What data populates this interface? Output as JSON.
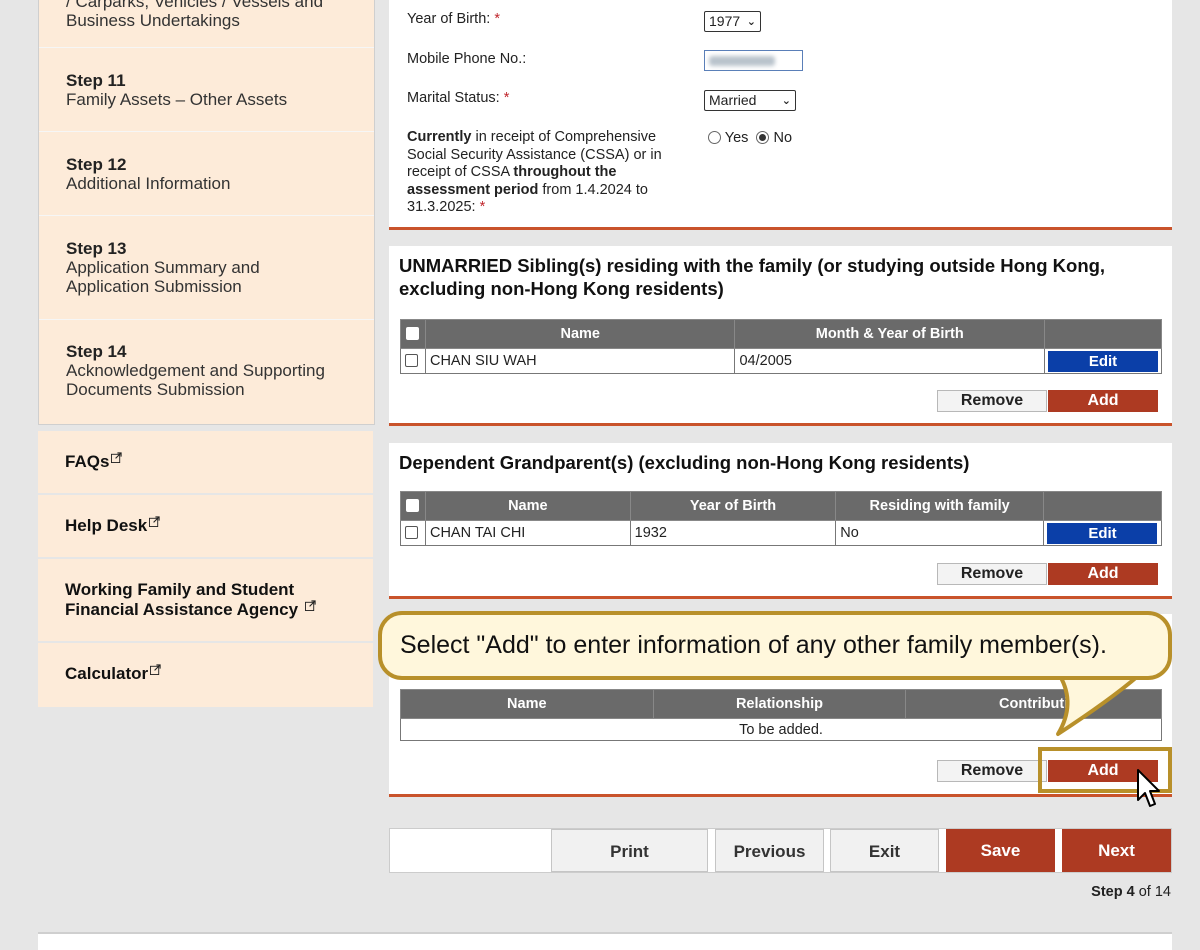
{
  "sidebar": {
    "partial_top": "/ Carparks, Vehicles / Vessels and Business Undertakings",
    "steps": [
      {
        "num": "Step 11",
        "label": "Family Assets – Other Assets"
      },
      {
        "num": "Step 12",
        "label": "Additional Information"
      },
      {
        "num": "Step 13",
        "label": "Application Summary and Application Submission"
      },
      {
        "num": "Step 14",
        "label": "Acknowledgement and Supporting Documents Submission"
      }
    ],
    "links": {
      "faqs": "FAQs",
      "help_desk": "Help Desk",
      "agency": "Working Family and Student Financial Assistance Agency",
      "calculator": "Calculator"
    }
  },
  "applicant": {
    "year_of_birth_label": "Year of Birth:",
    "year_of_birth_value": "1977",
    "mobile_label": "Mobile Phone No.:",
    "marital_label": "Marital Status:",
    "marital_value": "Married",
    "cssa_q_currently": "Currently",
    "cssa_q_part1": " in receipt of Comprehensive Social Security Assistance (CSSA) or in receipt of CSSA ",
    "cssa_q_throughout": "throughout the assessment period",
    "cssa_q_part2": " from 1.4.2024 to 31.3.2025:",
    "yes": "Yes",
    "no": "No",
    "required_mark": "*"
  },
  "siblings": {
    "title": "UNMARRIED Sibling(s) residing with the family (or studying outside Hong Kong, excluding non-Hong Kong residents)",
    "col_name": "Name",
    "col_birth": "Month & Year of Birth",
    "rows": [
      {
        "name": "CHAN SIU WAH",
        "birth": "04/2005"
      }
    ]
  },
  "grandparents": {
    "title": "Dependent Grandparent(s) (excluding non-Hong Kong residents)",
    "col_name": "Name",
    "col_birth": "Year of Birth",
    "col_residing": "Residing with family",
    "rows": [
      {
        "name": "CHAN TAI CHI",
        "birth": "1932",
        "residing": "No"
      }
    ]
  },
  "others": {
    "col_name": "Name",
    "col_relationship": "Relationship",
    "col_contribution": "Contributi",
    "empty_text": "To be added."
  },
  "buttons": {
    "edit": "Edit",
    "remove": "Remove",
    "add": "Add",
    "print": "Print",
    "previous": "Previous",
    "exit": "Exit",
    "save": "Save",
    "next": "Next"
  },
  "tooltip": "Select \"Add\" to enter information of any other family member(s).",
  "progress": {
    "step_word": "Step",
    "current": "4",
    "of_word": "of",
    "total": "14"
  },
  "colors": {
    "accent_red": "#ad3a22",
    "edit_blue": "#0b3fa8",
    "sidebar_bg": "#fdebd9",
    "highlight_gold": "#b8902a"
  }
}
